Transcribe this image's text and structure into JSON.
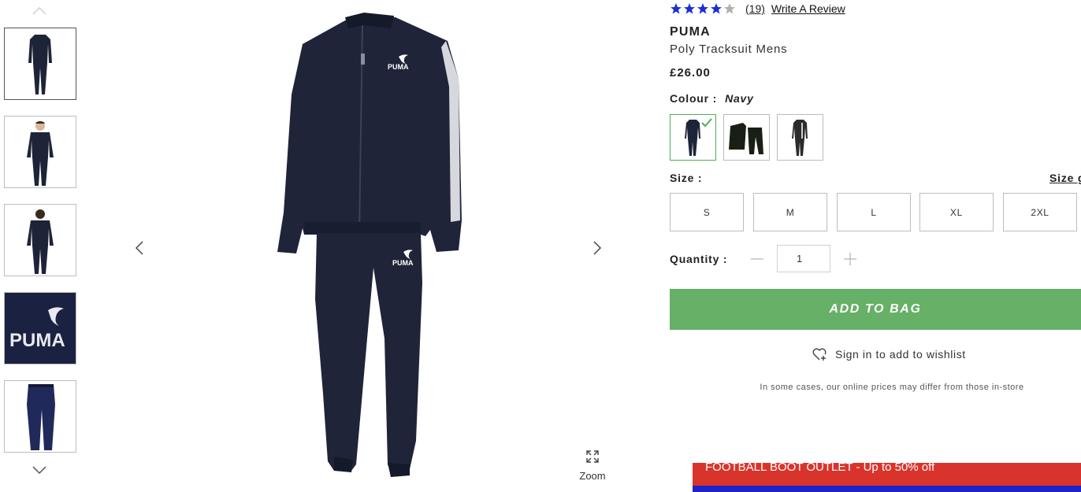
{
  "gallery": {
    "thumbnails": [
      {
        "alt": "navy tracksuit front"
      },
      {
        "alt": "model wearing tracksuit front"
      },
      {
        "alt": "model wearing tracksuit back"
      },
      {
        "alt": "PUMA logo close-up",
        "logo_text": "PUMA"
      },
      {
        "alt": "tracksuit pants"
      }
    ],
    "zoom_label": "Zoom",
    "jacket_logo": "PUMA"
  },
  "product": {
    "rating_stars": 4,
    "rating_max": 5,
    "rating_count": "(19)",
    "write_review": "Write A Review",
    "brand": "PUMA",
    "name": "Poly Tracksuit Mens",
    "price": "£26.00",
    "colour_label": "Colour :",
    "colour_value": "Navy",
    "size_label": "Size :",
    "size_guide": "Size g",
    "sizes": [
      "S",
      "M",
      "L",
      "XL",
      "2XL"
    ],
    "quantity_label": "Quantity :",
    "quantity_value": "1",
    "add_to_bag": "ADD TO BAG",
    "wishlist": "Sign in to add to wishlist",
    "price_note": "In some cases, our online prices may differ from those in-store"
  },
  "promo": {
    "text": "FOOTBALL BOOT OUTLET - Up to 50% off"
  },
  "colors": {
    "accent_green": "#66b067",
    "star_blue": "#1a2fd6",
    "navy": "#1e2438",
    "promo_red": "#d9342b",
    "promo_blue": "#1d22c9"
  }
}
